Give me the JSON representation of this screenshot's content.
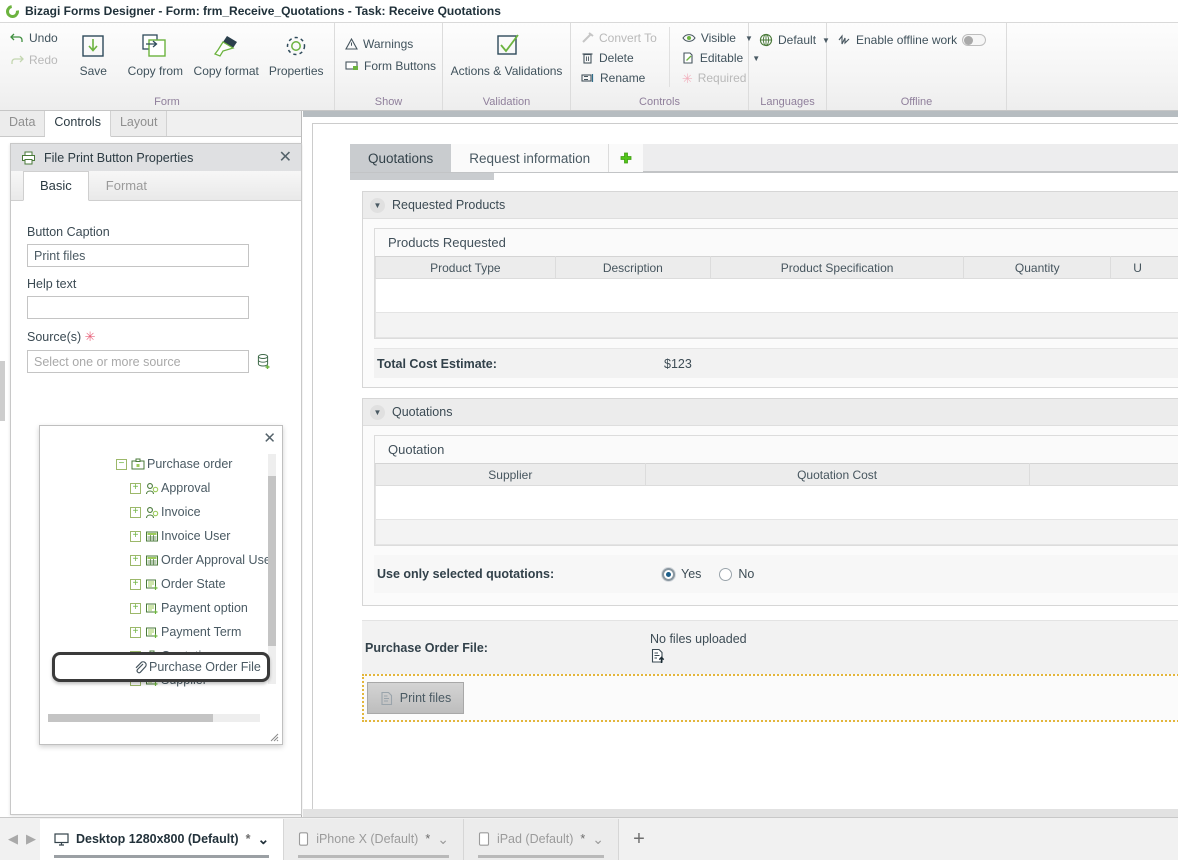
{
  "window": {
    "logo_icon": "bizagi-logo-icon",
    "title": "Bizagi Forms Designer  - Form: frm_Receive_Quotations - Task:  Receive Quotations"
  },
  "ribbon": {
    "groups": [
      {
        "label": "Form",
        "small_items": [
          {
            "label": "Undo",
            "icon": "undo-icon",
            "disabled": false
          },
          {
            "label": "Redo",
            "icon": "redo-icon",
            "disabled": true
          }
        ],
        "big_items": [
          {
            "label": "Save",
            "icon": "save-icon"
          },
          {
            "label": "Copy from",
            "icon": "copy-from-icon"
          },
          {
            "label": "Copy format",
            "icon": "copy-format-icon"
          },
          {
            "label": "Properties",
            "icon": "gear-icon"
          }
        ]
      },
      {
        "label": "Show",
        "small_items": [
          {
            "label": "Warnings",
            "icon": "warning-triangle-icon"
          },
          {
            "label": "Form Buttons",
            "icon": "form-buttons-icon"
          }
        ]
      },
      {
        "label": "Validation",
        "big_items": [
          {
            "label": "Actions & Validations",
            "icon": "checkbox-check-icon"
          }
        ]
      },
      {
        "label": "Controls",
        "small_items": [
          {
            "label": "Convert To",
            "icon": "convert-to-icon",
            "disabled": true
          },
          {
            "label": "Delete",
            "icon": "trash-icon",
            "disabled": false
          },
          {
            "label": "Rename",
            "icon": "rename-icon",
            "disabled": false
          }
        ],
        "small_items2": [
          {
            "label": "Visible",
            "icon": "eye-icon",
            "caret": true,
            "disabled": false
          },
          {
            "label": "Editable",
            "icon": "pencil-page-icon",
            "caret": true,
            "disabled": false
          },
          {
            "label": "Required",
            "icon": "asterisk-icon",
            "caret": false,
            "disabled": true
          }
        ]
      },
      {
        "label": "Languages",
        "small_items": [
          {
            "label": "Default",
            "icon": "globe-icon",
            "caret": true
          }
        ]
      },
      {
        "label": "Offline",
        "small_items": [
          {
            "label": "Enable offline work",
            "icon": "offline-icon",
            "toggle": "off"
          }
        ]
      }
    ]
  },
  "left_panel": {
    "tabs": [
      {
        "label": "Data",
        "active": false
      },
      {
        "label": "Controls",
        "active": true
      },
      {
        "label": "Layout",
        "active": false
      }
    ],
    "properties": {
      "icon": "printer-icon",
      "title": "File Print Button Properties",
      "close_icon": "close-icon",
      "tabs": [
        {
          "label": "Basic",
          "active": true
        },
        {
          "label": "Format",
          "active": false
        }
      ],
      "fields": [
        {
          "label": "Button Caption",
          "value": "Print files",
          "placeholder": "",
          "required": false
        },
        {
          "label": "Help text",
          "value": "",
          "placeholder": "",
          "required": false
        },
        {
          "label": "Source(s)",
          "value": "",
          "placeholder": "Select one or more source",
          "required": true,
          "required_mark": "✳",
          "action_icon": "add-source-icon"
        }
      ]
    },
    "tree_popup": {
      "close_icon": "close-icon",
      "nodes": [
        {
          "expander": "−",
          "icon": "entity-root-icon",
          "label": "Purchase order",
          "level": 0,
          "selected": false
        },
        {
          "expander": "+",
          "icon": "user-icon",
          "label": "Approval",
          "level": 1,
          "selected": false
        },
        {
          "expander": "+",
          "icon": "user-icon",
          "label": "Invoice",
          "level": 1,
          "selected": false
        },
        {
          "expander": "+",
          "icon": "table-icon",
          "label": "Invoice User",
          "level": 1,
          "selected": false
        },
        {
          "expander": "+",
          "icon": "table-icon",
          "label": "Order Approval User",
          "level": 1,
          "selected": false
        },
        {
          "expander": "+",
          "icon": "param-entity-icon",
          "label": "Order State",
          "level": 1,
          "selected": false
        },
        {
          "expander": "+",
          "icon": "param-entity-icon",
          "label": "Payment option",
          "level": 1,
          "selected": false
        },
        {
          "expander": "+",
          "icon": "param-entity-icon",
          "label": "Payment Term",
          "level": 1,
          "selected": false
        },
        {
          "expander": "",
          "icon": "paperclip-icon",
          "label": "Purchase Order File",
          "level": 1,
          "selected": true
        },
        {
          "expander": "+",
          "icon": "entity-root-icon",
          "label": "Quotation",
          "level": 1,
          "selected": false
        },
        {
          "expander": "+",
          "icon": "param-entity-icon",
          "label": "Supplier",
          "level": 1,
          "selected": false
        }
      ]
    }
  },
  "form": {
    "tabs": [
      {
        "label": "Quotations",
        "active": true
      },
      {
        "label": "Request information",
        "active": false
      }
    ],
    "add_tab_icon": "plus-icon",
    "sections": [
      {
        "title": "Requested Products",
        "chevron_icon": "chevron-down-icon",
        "grid": {
          "title": "Products Requested",
          "columns": [
            "Product Type",
            "Description",
            "Product Specification",
            "Quantity",
            "U"
          ]
        },
        "summary": {
          "key": "Total Cost Estimate:",
          "value": "$123"
        }
      },
      {
        "title": "Quotations",
        "chevron_icon": "chevron-down-icon",
        "grid": {
          "title": "Quotation",
          "columns": [
            "Supplier",
            "Quotation Cost",
            ""
          ]
        },
        "radio_field": {
          "key": "Use only selected quotations:",
          "options": [
            {
              "label": "Yes",
              "selected": true
            },
            {
              "label": "No",
              "selected": false
            }
          ]
        }
      }
    ],
    "file_field": {
      "key": "Purchase Order File:",
      "status": "No files uploaded",
      "upload_icon": "file-upload-icon"
    },
    "print_button": {
      "label": "Print files",
      "icon": "print-file-icon",
      "selected": true
    }
  },
  "device_bar": {
    "prev_icon": "left-arrow-icon",
    "next_icon": "right-arrow-icon",
    "add_icon": "plus-icon",
    "tabs": [
      {
        "icon": "desktop-icon",
        "label": "Desktop 1280x800 (Default)",
        "dirty": "*",
        "caret": "⌄",
        "active": true
      },
      {
        "icon": "phone-icon",
        "label": "iPhone X (Default)",
        "dirty": "*",
        "caret": "⌄",
        "active": false
      },
      {
        "icon": "tablet-icon",
        "label": "iPad (Default)",
        "dirty": "*",
        "caret": "⌄",
        "active": false
      }
    ]
  },
  "colors": {
    "accent_green": "#6cb33f",
    "ink": "#2b3a42",
    "group_label": "#8f7f9b",
    "selection_orange": "#e3b63c",
    "required_pink": "#e8647c"
  }
}
